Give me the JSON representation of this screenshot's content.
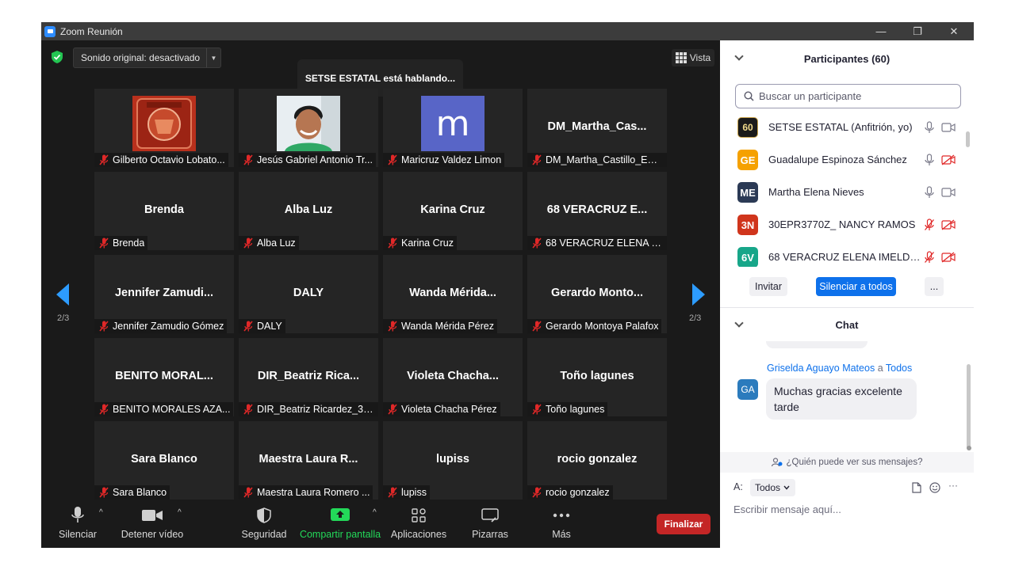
{
  "window": {
    "title": "Zoom Reunión",
    "controls": {
      "minimize": "—",
      "restore": "❐",
      "close": "✕"
    }
  },
  "topbar": {
    "sound_label": "Sonido original: desactivado",
    "speaking_text": "SETSE ESTATAL está hablando...",
    "view_label": "Vista"
  },
  "pagination": {
    "left": "2/3",
    "right": "2/3"
  },
  "tiles": [
    {
      "big": "",
      "name": "Gilberto Octavio Lobato...",
      "kind": "photo-seal"
    },
    {
      "big": "",
      "name": "Jesús Gabriel Antonio Tr...",
      "kind": "photo-person"
    },
    {
      "big": "",
      "name": "Maricruz Valdez Limon",
      "kind": "avatar",
      "avatar_letter": "m"
    },
    {
      "big": "DM_Martha_Cas...",
      "name": "DM_Martha_Castillo_EPR...",
      "kind": "text"
    },
    {
      "big": "Brenda",
      "name": "Brenda",
      "kind": "text"
    },
    {
      "big": "Alba Luz",
      "name": "Alba Luz",
      "kind": "text"
    },
    {
      "big": "Karina Cruz",
      "name": "Karina Cruz",
      "kind": "text"
    },
    {
      "big": "68 VERACRUZ E...",
      "name": "68 VERACRUZ ELENA IM...",
      "kind": "text"
    },
    {
      "big": "Jennifer  Zamudi...",
      "name": "Jennifer Zamudio Gómez",
      "kind": "text"
    },
    {
      "big": "DALY",
      "name": "DALY",
      "kind": "text"
    },
    {
      "big": "Wanda  Mérida...",
      "name": "Wanda Mérida Pérez",
      "kind": "text"
    },
    {
      "big": "Gerardo  Monto...",
      "name": "Gerardo Montoya Palafox",
      "kind": "text"
    },
    {
      "big": "BENITO  MORAL...",
      "name": "BENITO MORALES AZA...",
      "kind": "text"
    },
    {
      "big": "DIR_Beatriz  Rica...",
      "name": "DIR_Beatriz Ricardez_30...",
      "kind": "text"
    },
    {
      "big": "Violeta  Chacha...",
      "name": "Violeta Chacha Pérez",
      "kind": "text"
    },
    {
      "big": "Toño lagunes",
      "name": "Toño lagunes",
      "kind": "text"
    },
    {
      "big": "Sara Blanco",
      "name": "Sara Blanco",
      "kind": "text"
    },
    {
      "big": "Maestra  Laura  R...",
      "name": "Maestra Laura Romero ...",
      "kind": "text"
    },
    {
      "big": "lupiss",
      "name": "lupiss",
      "kind": "text"
    },
    {
      "big": "rocio gonzalez",
      "name": "rocio gonzalez",
      "kind": "text"
    }
  ],
  "toolbar": {
    "mute": "Silenciar",
    "stop_video": "Detener vídeo",
    "security": "Seguridad",
    "share": "Compartir pantalla",
    "apps": "Aplicaciones",
    "whiteboards": "Pizarras",
    "more": "Más",
    "end": "Finalizar"
  },
  "participants": {
    "title": "Participantes (60)",
    "search_placeholder": "Buscar un participante",
    "list": [
      {
        "initials": "60",
        "name": "SETSE ESTATAL (Anfitrión, yo)",
        "color": "#1a1a1a",
        "mic": "on",
        "cam": "on"
      },
      {
        "initials": "GE",
        "name": "Guadalupe Espinoza Sánchez",
        "color": "#f5a100",
        "mic": "on",
        "cam": "off"
      },
      {
        "initials": "ME",
        "name": "Martha Elena Nieves",
        "color": "#2b3a55",
        "mic": "on",
        "cam": "on"
      },
      {
        "initials": "3N",
        "name": "30EPR3770Z_ NANCY RAMOS",
        "color": "#d0351c",
        "mic": "off",
        "cam": "off"
      },
      {
        "initials": "6V",
        "name": "68 VERACRUZ ELENA IMELDA ...",
        "color": "#17a689",
        "mic": "off",
        "cam": "off"
      }
    ],
    "invite": "Invitar",
    "mute_all": "Silenciar a todos",
    "more": "..."
  },
  "chat": {
    "title": "Chat",
    "sender": "Griselda Aguayo Mateos",
    "to_word": "a",
    "recipient": "Todos",
    "sender_initials": "GA",
    "message": "Muchas gracias excelente tarde",
    "who_can_see": "¿Quién puede ver sus mensajes?",
    "to_label": "A:",
    "to_value": "Todos",
    "input_placeholder": "Escribir mensaje aquí...",
    "more": "···"
  },
  "colors": {
    "accent": "#0e71eb",
    "end": "#c42626",
    "share": "#23d959",
    "nav_arrow": "#2d9cff"
  }
}
